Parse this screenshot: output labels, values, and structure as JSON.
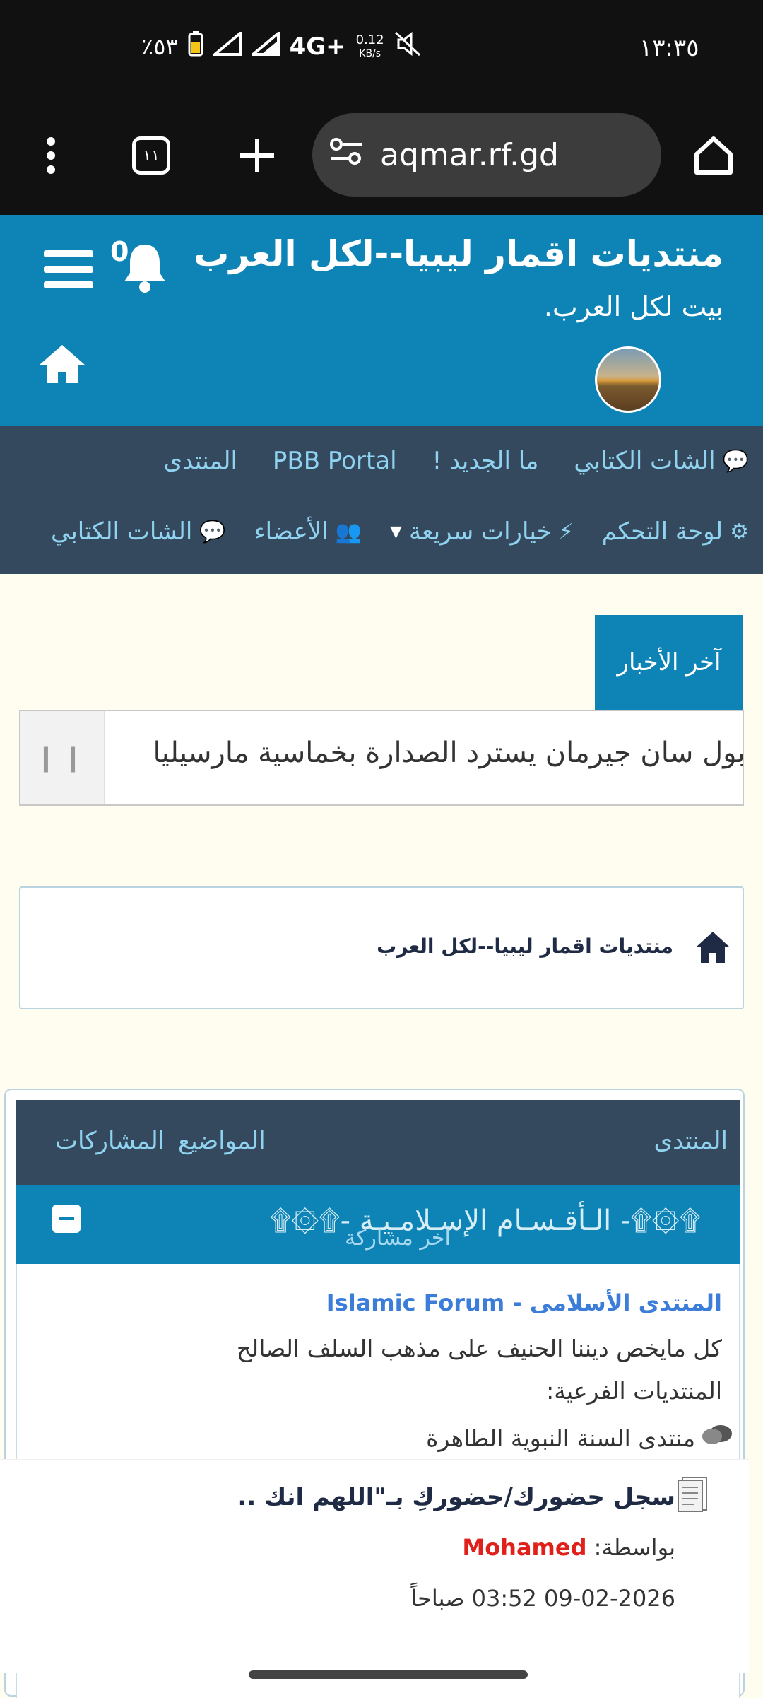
{
  "status_bar": {
    "time": "١٣:٣٥",
    "battery": "٪٥٣",
    "network": "4G+",
    "speed_value": "0.12",
    "speed_unit": "KB/s"
  },
  "browser": {
    "url": "aqmar.rf.gd",
    "tab_count": "١١"
  },
  "header": {
    "site_title": "منتديات اقمار ليبيا--لكل العرب",
    "site_description": "بيت لكل العرب.",
    "notification_count": "0"
  },
  "nav": {
    "row1": [
      {
        "label": "المنتدى"
      },
      {
        "label": "PBB Portal"
      },
      {
        "label": "ما الجديد !"
      },
      {
        "label": "الشات الكتابي",
        "icon": "chat-icon"
      }
    ],
    "row2": [
      {
        "label": "الشات الكتابي",
        "icon": "chat-icon"
      },
      {
        "label": "الأعضاء",
        "icon": "users-icon"
      },
      {
        "label": "خيارات سريعة",
        "icon": "bolt-icon"
      },
      {
        "label": "لوحة التحكم",
        "icon": "gears-icon"
      }
    ]
  },
  "news": {
    "tab_label": "آخر الأخبار",
    "ticker_text": "بول   سان جيرمان يسترد الصدارة بخماسية مارسيليا",
    "pause_symbol": "❙❙"
  },
  "breadcrumb": {
    "text": "منتديات اقمار ليبيا--لكل العرب"
  },
  "forum_table": {
    "columns": {
      "forum": "المنتدى",
      "topics": "المواضيع",
      "posts": "المشاركات"
    },
    "category": {
      "title": "۩۞۩- الـأقـسـام الإسـلامـيـة -۩۞۩",
      "last_post_header": "آخر مشاركة"
    },
    "forum": {
      "name": "المنتدى الأسلامى - Islamic Forum",
      "description": "كل مايخص ديننا الحنيف على مذهب السلف الصالح",
      "subforums_label": "المنتديات الفرعية:",
      "subforum": "منتدى السنة النبوية الطاهرة"
    },
    "last_post": {
      "title": "سجل حضورك/حضوركِ بـ\"اللهم انك ..",
      "by_label": "بواسطة:",
      "author": "Mohamed",
      "date": "09-02-2026 03:52 صباحاً"
    }
  },
  "colors": {
    "header_blue": "#0e83b5",
    "nav_dark": "#34495e",
    "nav_text": "#8fd3f0",
    "page_bg": "#fffdf0",
    "author_red": "#e0201a",
    "forum_link": "#3b7dd8"
  }
}
